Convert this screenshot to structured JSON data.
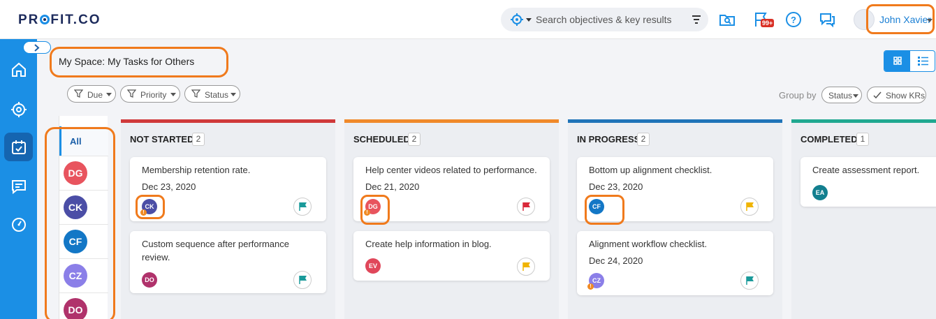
{
  "header": {
    "logo_text": "PROFIT.CO",
    "search_placeholder": "Search objectives & key results",
    "notification_badge": "99+",
    "user_name": "John Xavier"
  },
  "page": {
    "title": "My Space: My Tasks for Others",
    "filters": [
      "Due",
      "Priority",
      "Status"
    ],
    "group_by_label": "Group by",
    "group_by_value": "Status",
    "show_krs_label": "Show KRs"
  },
  "assignees": {
    "all_label": "All",
    "items": [
      {
        "initials": "DG",
        "color": "#e8545e"
      },
      {
        "initials": "CK",
        "color": "#4b4ea6"
      },
      {
        "initials": "CF",
        "color": "#1377c6"
      },
      {
        "initials": "CZ",
        "color": "#8b7fe8"
      },
      {
        "initials": "DO",
        "color": "#b0326b"
      }
    ]
  },
  "columns": [
    {
      "title": "NOT STARTED",
      "count": "2",
      "color": "#d0393a",
      "cards": [
        {
          "title": "Membership retention rate.",
          "date": "Dec 23, 2020",
          "avatar": "CK",
          "avatar_color": "#4b4ea6",
          "warn": true,
          "flag_color": "#1a9a9a"
        },
        {
          "title": "Custom sequence after performance review.",
          "date": "",
          "avatar": "DO",
          "avatar_color": "#b0326b",
          "warn": false,
          "flag_color": "#1a9a9a"
        }
      ]
    },
    {
      "title": "SCHEDULED",
      "count": "2",
      "color": "#f0892a",
      "cards": [
        {
          "title": "Help center videos related to performance.",
          "date": "Dec 21, 2020",
          "avatar": "DG",
          "avatar_color": "#e8545e",
          "warn": true,
          "flag_color": "#d9283a"
        },
        {
          "title": "Create help information in blog.",
          "date": "",
          "avatar": "EV",
          "avatar_color": "#e0475a",
          "warn": false,
          "flag_color": "#f0b400"
        }
      ]
    },
    {
      "title": "IN PROGRESS",
      "count": "2",
      "color": "#1f74b8",
      "cards": [
        {
          "title": "Bottom up alignment checklist.",
          "date": "Dec 23, 2020",
          "avatar": "CF",
          "avatar_color": "#1377c6",
          "warn": false,
          "flag_color": "#f0b400"
        },
        {
          "title": "Alignment workflow checklist.",
          "date": "Dec 24, 2020",
          "avatar": "CZ",
          "avatar_color": "#8b7fe8",
          "warn": true,
          "flag_color": "#1a9a9a"
        }
      ]
    },
    {
      "title": "COMPLETED",
      "count": "1",
      "color": "#1fa890",
      "cards": [
        {
          "title": "Create assessment report.",
          "date": "",
          "avatar": "EA",
          "avatar_color": "#127f8f",
          "warn": false,
          "flag_color": ""
        }
      ]
    }
  ]
}
